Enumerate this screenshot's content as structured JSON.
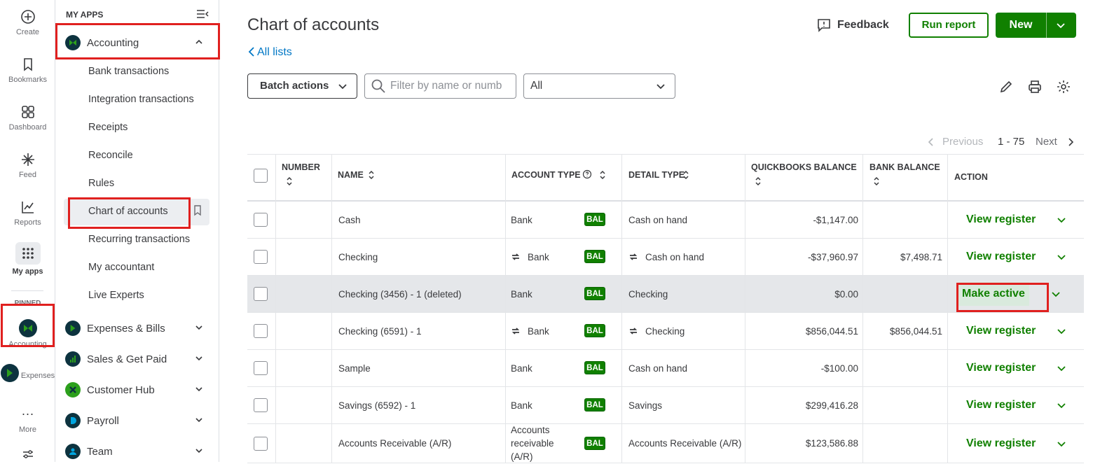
{
  "rail": {
    "create": "Create",
    "bookmarks": "Bookmarks",
    "dashboard": "Dashboard",
    "feed": "Feed",
    "reports": "Reports",
    "my_apps": "My apps",
    "pinned": "PINNED",
    "accounting": "Accounting",
    "expenses": "Expenses",
    "more": "More"
  },
  "sidebar": {
    "heading": "MY APPS",
    "apps": [
      {
        "label": "Accounting",
        "icon": "accounting-logo-icon",
        "expanded": true
      },
      {
        "label": "Expenses & Bills",
        "icon": "expenses-logo-icon"
      },
      {
        "label": "Sales & Get Paid",
        "icon": "sales-logo-icon"
      },
      {
        "label": "Customer Hub",
        "icon": "customer-hub-logo-icon"
      },
      {
        "label": "Payroll",
        "icon": "payroll-logo-icon"
      },
      {
        "label": "Team",
        "icon": "team-logo-icon"
      }
    ],
    "accounting_items": [
      "Bank transactions",
      "Integration transactions",
      "Receipts",
      "Reconcile",
      "Rules",
      "Chart of accounts",
      "Recurring transactions",
      "My accountant",
      "Live Experts"
    ],
    "active_item": "Chart of accounts"
  },
  "header": {
    "title": "Chart of accounts",
    "back_link": "All lists",
    "feedback": "Feedback",
    "run_report": "Run report",
    "new": "New"
  },
  "toolbar": {
    "batch_actions": "Batch actions",
    "filter_placeholder": "Filter by name or numb",
    "select_value": "All"
  },
  "pager": {
    "previous": "Previous",
    "range": "1 - 75",
    "next": "Next"
  },
  "table": {
    "columns": [
      "NUMBER",
      "NAME",
      "ACCOUNT TYPE",
      "DETAIL TYPE",
      "QUICKBOOKS BALANCE",
      "BANK BALANCE",
      "ACTION"
    ],
    "badge": "BAL",
    "rows": [
      {
        "number": "",
        "name": "Cash",
        "account_type": "Bank",
        "account_type_linked": false,
        "detail_type": "Cash on hand",
        "detail_linked": false,
        "qb_balance": "-$1,147.00",
        "bank_balance": "",
        "action": "View register",
        "highlight": false
      },
      {
        "number": "",
        "name": "Checking",
        "account_type": "Bank",
        "account_type_linked": true,
        "detail_type": "Cash on hand",
        "detail_linked": true,
        "qb_balance": "-$37,960.97",
        "bank_balance": "$7,498.71",
        "action": "View register",
        "highlight": false
      },
      {
        "number": "",
        "name": "Checking (3456) - 1 (deleted)",
        "account_type": "Bank",
        "account_type_linked": false,
        "detail_type": "Checking",
        "detail_linked": false,
        "qb_balance": "$0.00",
        "bank_balance": "",
        "action": "Make active",
        "highlight": true
      },
      {
        "number": "",
        "name": "Checking (6591) - 1",
        "account_type": "Bank",
        "account_type_linked": true,
        "detail_type": "Checking",
        "detail_linked": true,
        "qb_balance": "$856,044.51",
        "bank_balance": "$856,044.51",
        "action": "View register",
        "highlight": false
      },
      {
        "number": "",
        "name": "Sample",
        "account_type": "Bank",
        "account_type_linked": false,
        "detail_type": "Cash on hand",
        "detail_linked": false,
        "qb_balance": "-$100.00",
        "bank_balance": "",
        "action": "View register",
        "highlight": false
      },
      {
        "number": "",
        "name": "Savings (6592) - 1",
        "account_type": "Bank",
        "account_type_linked": false,
        "detail_type": "Savings",
        "detail_linked": false,
        "qb_balance": "$299,416.28",
        "bank_balance": "",
        "action": "View register",
        "highlight": false
      },
      {
        "number": "",
        "name": "Accounts Receivable (A/R)",
        "account_type": "Accounts receivable (A/R)",
        "account_type_linked": false,
        "detail_type": "Accounts Receivable (A/R)",
        "detail_linked": false,
        "qb_balance": "$123,586.88",
        "bank_balance": "",
        "action": "View register",
        "highlight": false
      }
    ]
  },
  "colors": {
    "brand_green": "#108000",
    "link_blue": "#0077c5",
    "highlight_red": "#e0201f"
  }
}
